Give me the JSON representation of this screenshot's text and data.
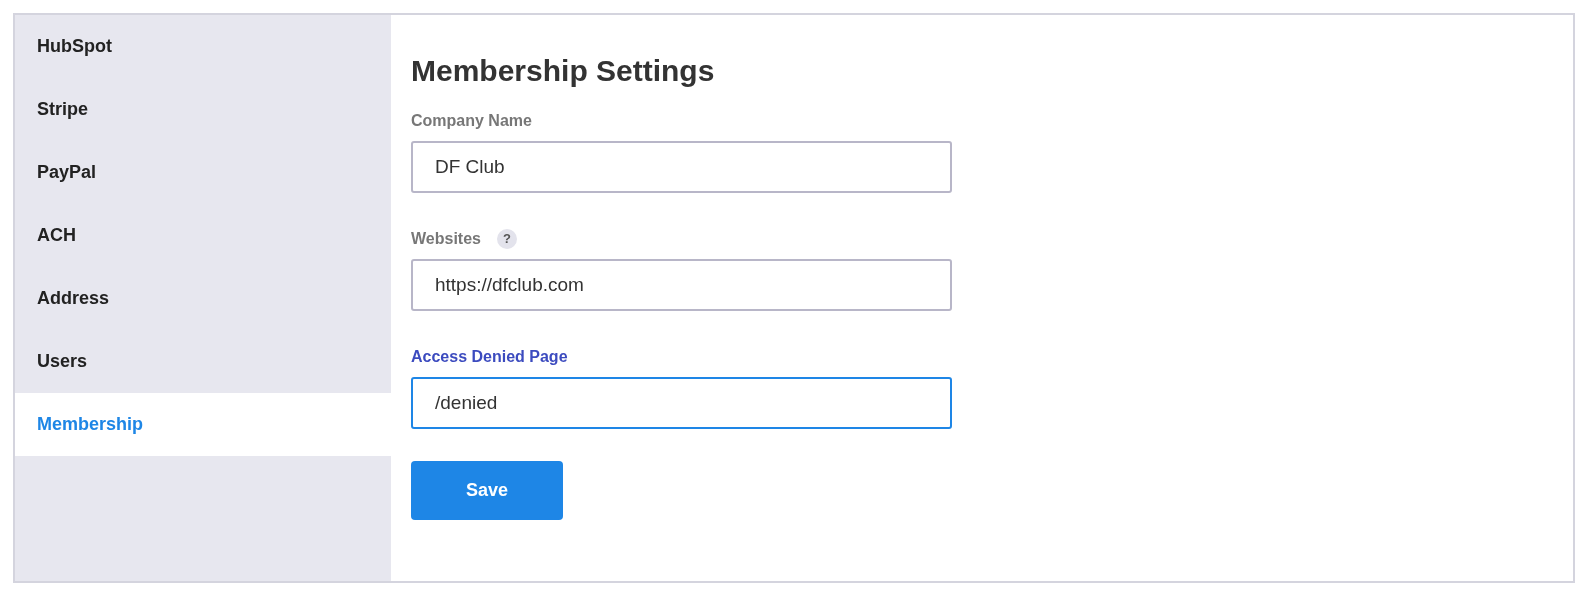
{
  "sidebar": {
    "items": [
      {
        "label": "HubSpot",
        "selected": false
      },
      {
        "label": "Stripe",
        "selected": false
      },
      {
        "label": "PayPal",
        "selected": false
      },
      {
        "label": "ACH",
        "selected": false
      },
      {
        "label": "Address",
        "selected": false
      },
      {
        "label": "Users",
        "selected": false
      },
      {
        "label": "Membership",
        "selected": true
      }
    ]
  },
  "content": {
    "title": "Membership Settings",
    "fields": [
      {
        "label": "Company Name",
        "value": "DF Club",
        "focused": false
      },
      {
        "label": "Websites",
        "value": "https://dfclub.com",
        "help_text": "?",
        "focused": false
      },
      {
        "label": "Access Denied Page",
        "value": "/denied",
        "focused": true
      }
    ],
    "save_button": "Save"
  }
}
